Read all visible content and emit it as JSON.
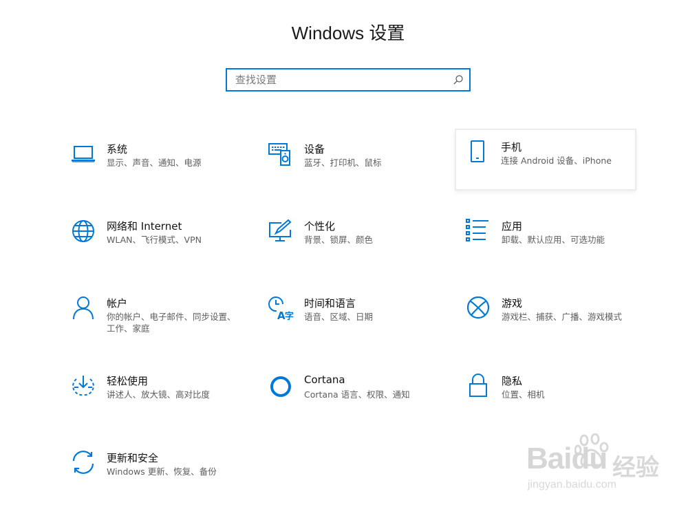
{
  "window": {
    "title": "Windows 设置"
  },
  "search": {
    "placeholder": "查找设置"
  },
  "colors": {
    "accent": "#0078d7",
    "title": "#111111",
    "description": "#5d5d5d"
  },
  "tiles": [
    {
      "title": "系统",
      "desc": "显示、声音、通知、电源",
      "icon": "laptop-icon"
    },
    {
      "title": "设备",
      "desc": "蓝牙、打印机、鼠标",
      "icon": "devices-icon"
    },
    {
      "title": "手机",
      "desc": "连接 Android 设备、iPhone",
      "icon": "phone-icon"
    },
    {
      "title": "网络和 Internet",
      "desc": "WLAN、飞行模式、VPN",
      "icon": "globe-icon"
    },
    {
      "title": "个性化",
      "desc": "背景、锁屏、颜色",
      "icon": "personalization-icon"
    },
    {
      "title": "应用",
      "desc": "卸载、默认应用、可选功能",
      "icon": "apps-list-icon"
    },
    {
      "title": "帐户",
      "desc": "你的帐户、电子邮件、同步设置、工作、家庭",
      "icon": "person-icon"
    },
    {
      "title": "时间和语言",
      "desc": "语音、区域、日期",
      "icon": "time-language-icon"
    },
    {
      "title": "游戏",
      "desc": "游戏栏、捕获、广播、游戏模式",
      "icon": "xbox-icon"
    },
    {
      "title": "轻松使用",
      "desc": "讲述人、放大镜、高对比度",
      "icon": "ease-of-access-icon"
    },
    {
      "title": "Cortana",
      "desc": "Cortana 语言、权限、通知",
      "icon": "cortana-icon"
    },
    {
      "title": "隐私",
      "desc": "位置、相机",
      "icon": "lock-icon"
    },
    {
      "title": "更新和安全",
      "desc": "Windows 更新、恢复、备份",
      "icon": "sync-icon"
    }
  ],
  "watermark": {
    "logo": "Baidu",
    "cn": "经验",
    "url": "jingyan.baidu.com"
  }
}
